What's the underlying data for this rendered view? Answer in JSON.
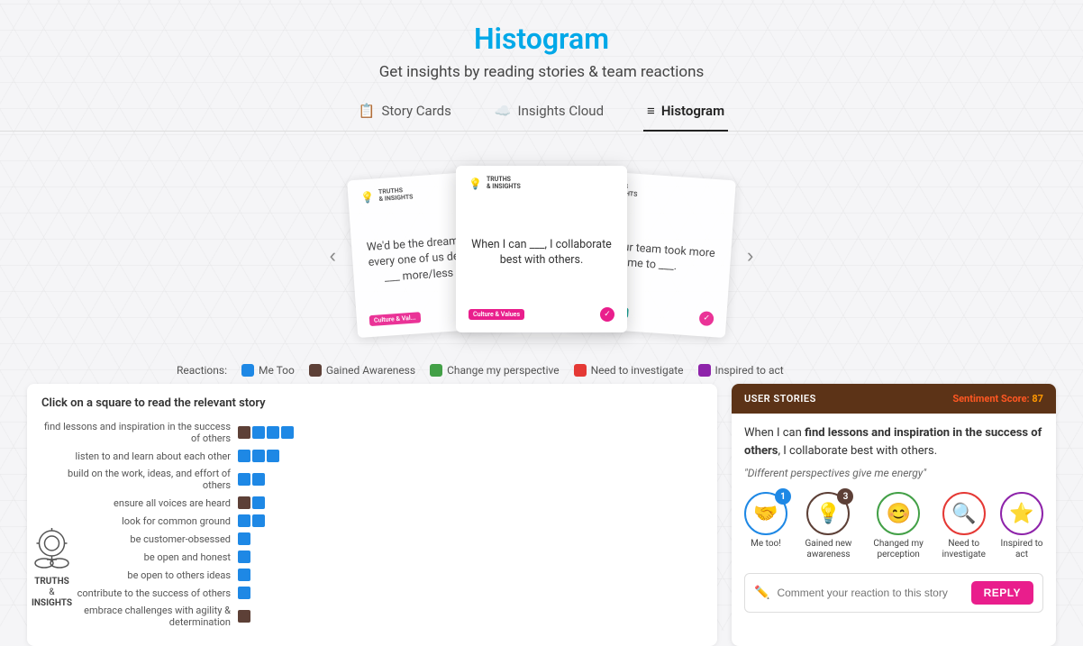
{
  "page": {
    "title": "Histogram",
    "subtitle": "Get insights by reading stories & team reactions"
  },
  "tabs": [
    {
      "id": "story-cards",
      "label": "Story Cards",
      "icon": "📋",
      "active": false
    },
    {
      "id": "insights-cloud",
      "label": "Insights Cloud",
      "icon": "☁️",
      "active": false
    },
    {
      "id": "histogram",
      "label": "Histogram",
      "icon": "≡",
      "active": true
    }
  ],
  "carousel": {
    "prev_arrow": "‹",
    "next_arrow": "›",
    "cards": [
      {
        "id": "left",
        "text": "We'd be the dream team, if every one of us decided to ___ more/less often.",
        "tag": "Culture & Val..."
      },
      {
        "id": "center",
        "text": "When I can ___, I collaborate best with others.",
        "tag": "Culture & Values"
      },
      {
        "id": "right",
        "text": "I wish our team took more time to ___.",
        "tag": "Culture & Val..."
      }
    ]
  },
  "reactions_legend": {
    "label": "Reactions:",
    "items": [
      {
        "id": "me-too",
        "label": "Me Too",
        "color": "#1e88e5"
      },
      {
        "id": "gained-awareness",
        "label": "Gained Awareness",
        "color": "#5d4037"
      },
      {
        "id": "change-perspective",
        "label": "Change my perspective",
        "color": "#43a047"
      },
      {
        "id": "need-investigate",
        "label": "Need to investigate",
        "color": "#e53935"
      },
      {
        "id": "inspired-to-act",
        "label": "Inspired to act",
        "color": "#8e24aa"
      }
    ]
  },
  "histogram": {
    "title": "Click on a square to read the relevant story",
    "rows": [
      {
        "label": "find lessons and inspiration in the success of others",
        "bars": [
          {
            "color": "#5d4037",
            "count": 1
          },
          {
            "color": "#1e88e5",
            "count": 1
          },
          {
            "color": "#1e88e5",
            "count": 1
          },
          {
            "color": "#1e88e5",
            "count": 1
          }
        ]
      },
      {
        "label": "listen to and learn about each other",
        "bars": [
          {
            "color": "#1e88e5",
            "count": 1
          },
          {
            "color": "#1e88e5",
            "count": 1
          },
          {
            "color": "#1e88e5",
            "count": 1
          }
        ]
      },
      {
        "label": "build on the work, ideas, and effort of others",
        "bars": [
          {
            "color": "#1e88e5",
            "count": 1
          },
          {
            "color": "#1e88e5",
            "count": 1
          }
        ]
      },
      {
        "label": "ensure all voices are heard",
        "bars": [
          {
            "color": "#5d4037",
            "count": 1
          },
          {
            "color": "#1e88e5",
            "count": 1
          }
        ]
      },
      {
        "label": "look for common ground",
        "bars": [
          {
            "color": "#1e88e5",
            "count": 1
          },
          {
            "color": "#1e88e5",
            "count": 1
          }
        ]
      },
      {
        "label": "be customer-obsessed",
        "bars": [
          {
            "color": "#1e88e5",
            "count": 1
          }
        ]
      },
      {
        "label": "be open and honest",
        "bars": [
          {
            "color": "#1e88e5",
            "count": 1
          }
        ]
      },
      {
        "label": "be open to others ideas",
        "bars": [
          {
            "color": "#1e88e5",
            "count": 1
          }
        ]
      },
      {
        "label": "contribute to the success of others",
        "bars": [
          {
            "color": "#1e88e5",
            "count": 1
          }
        ]
      },
      {
        "label": "embrace challenges with agility & determination",
        "bars": [
          {
            "color": "#5d4037",
            "count": 1
          }
        ]
      }
    ]
  },
  "story_panel": {
    "header_title": "USER STORIES",
    "sentiment_label": "Sentiment Score:",
    "sentiment_value": "87",
    "story_text_parts": [
      {
        "text": "When I can ",
        "bold": false
      },
      {
        "text": "find lessons and inspiration in the success of others",
        "bold": true
      },
      {
        "text": ", I collaborate best with others.",
        "bold": false
      }
    ],
    "story_quote": "\"Different perspectives give me energy\"",
    "reactions": [
      {
        "id": "me-too",
        "emoji": "🤝",
        "label": "Me too!",
        "color": "#1e88e5",
        "count": null
      },
      {
        "id": "gained-awareness",
        "emoji": "💡",
        "label": "Gained new awareness",
        "color": "#5d4037",
        "count": "3"
      },
      {
        "id": "changed-perception",
        "emoji": "😊",
        "label": "Changed my perception",
        "color": "#43a047",
        "count": null
      },
      {
        "id": "need-investigate",
        "emoji": "🔍",
        "label": "Need to investigate",
        "color": "#e53935",
        "count": null
      },
      {
        "id": "inspired-act",
        "emoji": "⭐",
        "label": "Inspired to act",
        "color": "#8e24aa",
        "count": null
      }
    ],
    "reaction_badge_1_count": "1",
    "reaction_badge_2_count": "3",
    "comment_placeholder": "Comment your reaction to this story",
    "reply_label": "REPLY"
  },
  "brand": {
    "name_line1": "TRUTHS",
    "name_and": "&",
    "name_line2": "INSIGHTS"
  }
}
